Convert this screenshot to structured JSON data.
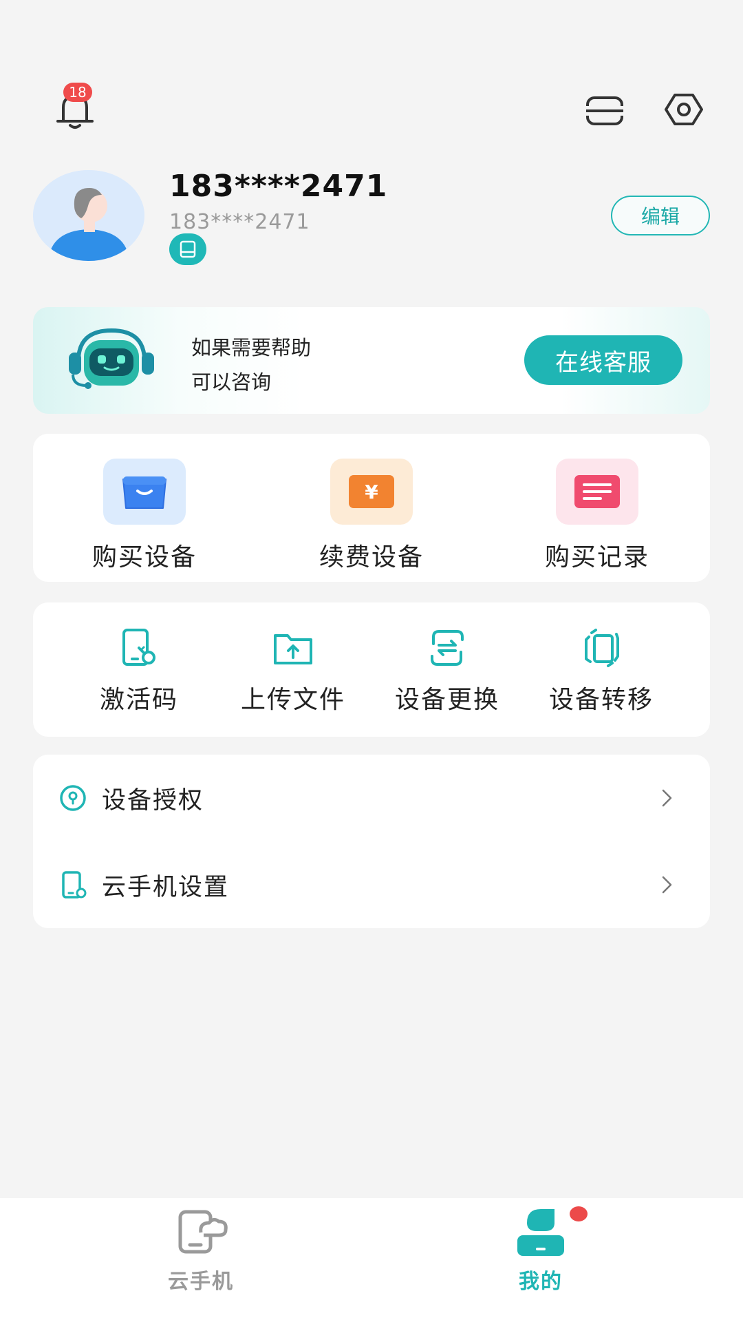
{
  "header": {
    "notification_count": "18"
  },
  "profile": {
    "name": "183****2471",
    "phone": "183****2471",
    "edit_label": "编辑"
  },
  "help": {
    "line1": "如果需要帮助",
    "line2": "可以咨询",
    "button_label": "在线客服"
  },
  "purchase": {
    "items": [
      {
        "label": "购买设备",
        "icon": "buy-device-icon"
      },
      {
        "label": "续费设备",
        "icon": "renew-device-icon"
      },
      {
        "label": "购买记录",
        "icon": "purchase-record-icon"
      }
    ]
  },
  "tools": {
    "items": [
      {
        "label": "激活码",
        "icon": "activation-code-icon"
      },
      {
        "label": "上传文件",
        "icon": "upload-file-icon"
      },
      {
        "label": "设备更换",
        "icon": "device-swap-icon"
      },
      {
        "label": "设备转移",
        "icon": "device-transfer-icon"
      }
    ]
  },
  "list": {
    "items": [
      {
        "label": "设备授权",
        "icon": "lock-icon"
      },
      {
        "label": "云手机设置",
        "icon": "phone-settings-icon"
      }
    ]
  },
  "nav": {
    "items": [
      {
        "label": "云手机",
        "active": false
      },
      {
        "label": "我的",
        "active": true
      }
    ]
  },
  "colors": {
    "accent": "#1fb5b4",
    "badge_red": "#ef4b4b",
    "inactive_nav": "#9a9a9a"
  }
}
